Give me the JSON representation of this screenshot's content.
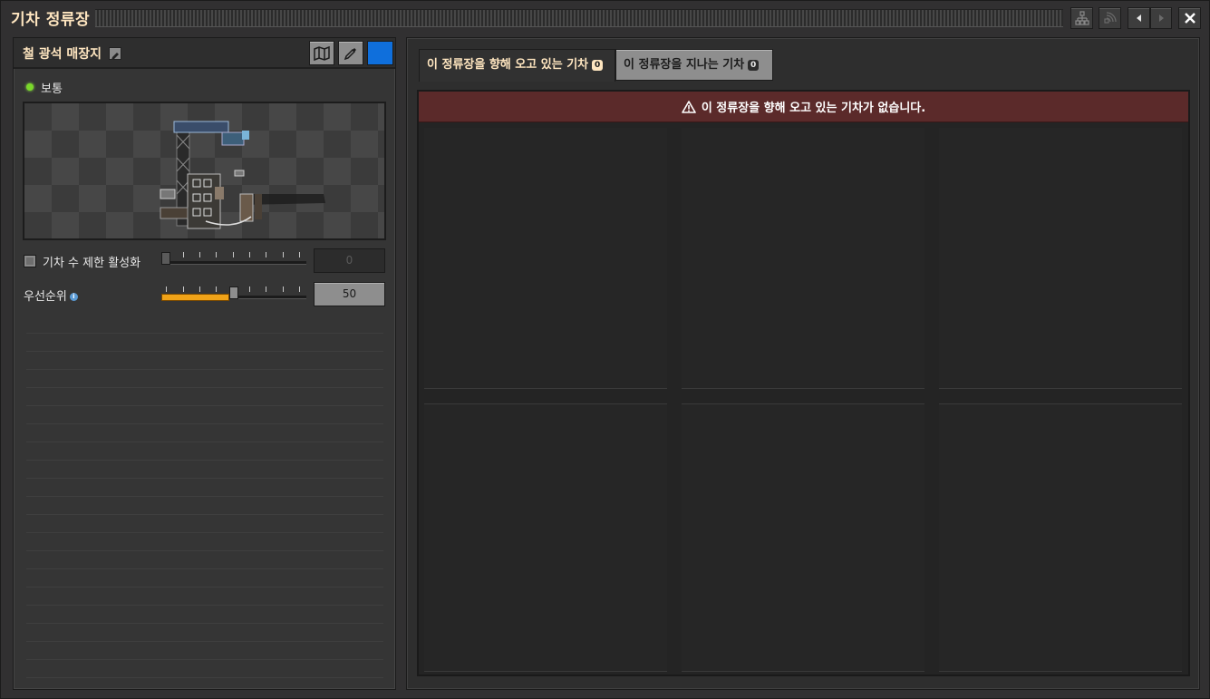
{
  "window": {
    "title": "기차 정류장"
  },
  "titlebar_buttons": [
    {
      "name": "network-icon"
    },
    {
      "name": "signal-icon"
    },
    {
      "name": "arrow-left-icon"
    },
    {
      "name": "arrow-right-icon"
    },
    {
      "name": "close-icon"
    }
  ],
  "station": {
    "name": "철 광석 매장지",
    "status": "보통",
    "status_color": "#7ad82a",
    "color": "#0f6fdc"
  },
  "train_limit": {
    "label": "기차 수 제한 활성화",
    "enabled": false,
    "value": "0"
  },
  "priority": {
    "label": "우선순위",
    "value": "50",
    "fraction": 0.5,
    "fill_color": "#f0a318"
  },
  "tabs": [
    {
      "label": "이 정류장을 향해 오고 있는 기차",
      "count": "0",
      "active": true
    },
    {
      "label": "이 정류장을 지나는 기차",
      "count": "0",
      "active": false
    }
  ],
  "warning": {
    "text": "이 정류장을 향해 오고 있는 기차가 없습니다.",
    "bg_color": "#5b2a2a"
  }
}
